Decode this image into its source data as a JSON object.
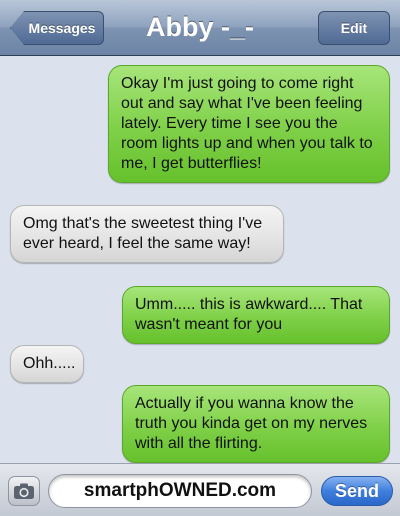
{
  "header": {
    "back_label": "Messages",
    "title": "Abby -_-",
    "edit_label": "Edit"
  },
  "messages": [
    {
      "direction": "sent",
      "text": "Okay I'm just going to come right out and say what I've been feeling lately. Every time I see you the room lights up and when you talk to me, I get butterflies!"
    },
    {
      "direction": "received",
      "text": "Omg that's the sweetest thing I've ever heard, I feel the same way!"
    },
    {
      "direction": "sent",
      "text": "Umm..... this is awkward.... That wasn't meant for you"
    },
    {
      "direction": "received",
      "text": "Ohh....."
    },
    {
      "direction": "sent",
      "text": "Actually if you wanna know the truth you kinda get on my nerves with all the flirting."
    }
  ],
  "input_bar": {
    "camera_icon": "camera-icon",
    "field_text": "smartphOWNED.com",
    "send_label": "Send"
  },
  "colors": {
    "sent_bubble": "#7fd048",
    "received_bubble": "#e3e3e3",
    "nav_bar": "#7d93b1",
    "send_button": "#3f7fdd",
    "background": "#dbe2ed"
  }
}
